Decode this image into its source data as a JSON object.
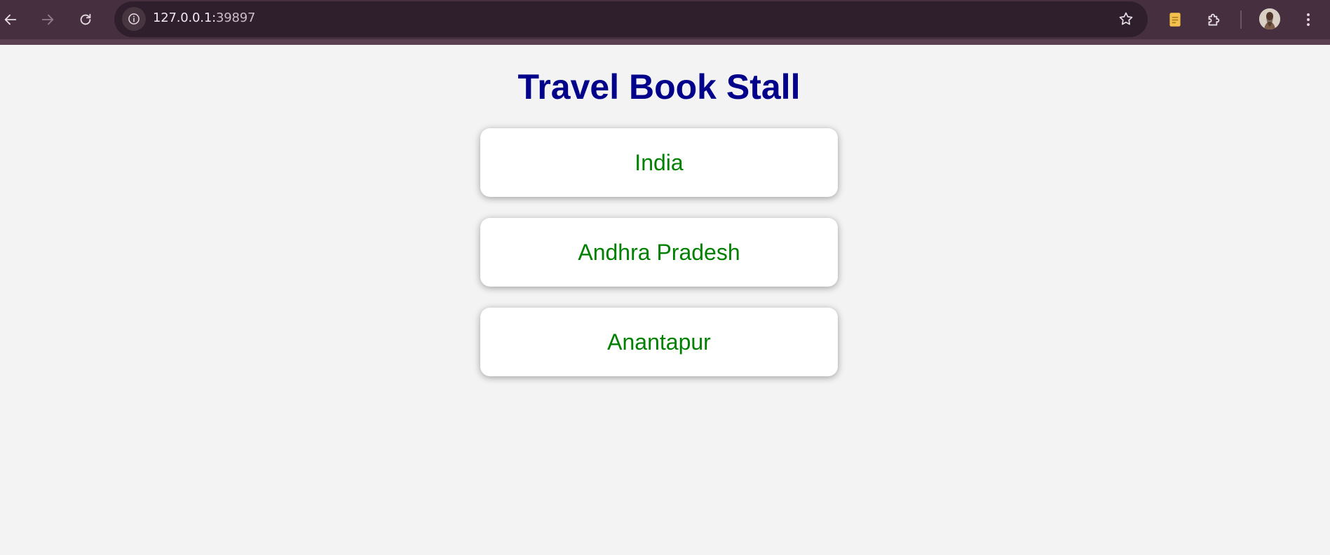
{
  "browser": {
    "url_host": "127.0.0.1:",
    "url_port": "39897",
    "icons": {
      "back": "arrow-left-icon",
      "forward": "arrow-right-icon",
      "reload": "reload-icon",
      "site_info": "info-icon",
      "bookmark": "star-icon",
      "notes_extension": "notepad-icon",
      "extensions": "puzzle-icon",
      "profile": "avatar",
      "menu": "kebab-menu-icon"
    },
    "colors": {
      "toolbar": "#46303f",
      "omnibox": "#2f1f2c"
    }
  },
  "page": {
    "title": "Travel Book Stall",
    "title_color": "#00008b",
    "link_color": "#008000",
    "items": [
      {
        "label": "India"
      },
      {
        "label": "Andhra Pradesh"
      },
      {
        "label": "Anantapur"
      }
    ]
  }
}
